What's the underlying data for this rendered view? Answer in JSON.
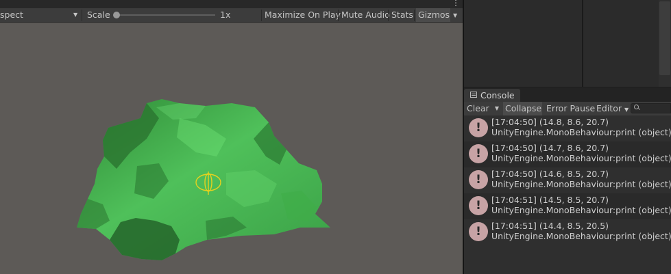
{
  "game_view": {
    "aspect_label": "spect",
    "scale_label": "Scale",
    "scale_value": "1x",
    "buttons": {
      "maximize": "Maximize On Play",
      "mute": "Mute Audio",
      "stats": "Stats",
      "gizmos": "Gizmos"
    },
    "more_icon": "⋮",
    "dropdown_icon": "▼"
  },
  "console": {
    "tab_label": "Console",
    "toolbar": {
      "clear": "Clear",
      "collapse": "Collapse",
      "error_pause": "Error Pause",
      "editor": "Editor"
    },
    "error_icon_glyph": "!",
    "error_icon_color": "#c7a3a5",
    "logs": [
      {
        "message": "[17:04:50] (14.8, 8.6, 20.7)",
        "source": "UnityEngine.MonoBehaviour:print (object)"
      },
      {
        "message": "[17:04:50] (14.7, 8.6, 20.7)",
        "source": "UnityEngine.MonoBehaviour:print (object)"
      },
      {
        "message": "[17:04:50] (14.6, 8.5, 20.7)",
        "source": "UnityEngine.MonoBehaviour:print (object)"
      },
      {
        "message": "[17:04:51] (14.5, 8.5, 20.7)",
        "source": "UnityEngine.MonoBehaviour:print (object)"
      },
      {
        "message": "[17:04:51] (14.4, 8.5, 20.5)",
        "source": "UnityEngine.MonoBehaviour:print (object)"
      }
    ]
  },
  "colors": {
    "viewport_background": "#5d5a57",
    "terrain_green": "#3ea043",
    "gizmo_yellow": "#e6d21e"
  }
}
